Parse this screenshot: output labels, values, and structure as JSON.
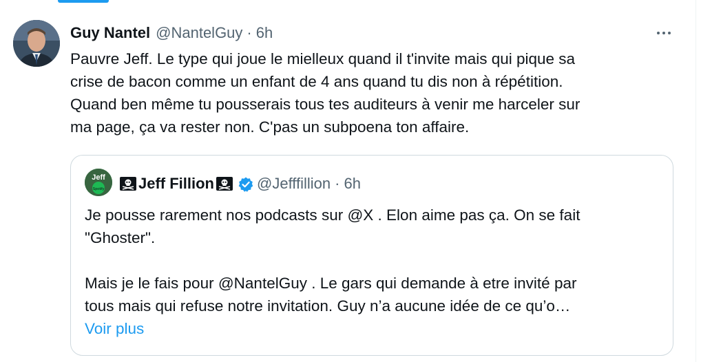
{
  "tweet": {
    "author_name": "Guy Nantel",
    "author_handle": "@NantelGuy",
    "separator": "·",
    "time": "6h",
    "text_lines": [
      "Pauvre Jeff. Le type qui joue le mielleux quand il t'invite mais qui pique sa",
      "crise de bacon comme un enfant de 4 ans quand tu dis non à répétition.",
      "Quand ben même tu pousserais tous tes auditeurs à venir me harceler sur",
      "ma page, ça va rester non. C'pas un subpoena ton affaire."
    ],
    "more_icon": "ellipsis-icon"
  },
  "quote": {
    "avatar_label_top": "Jeff",
    "avatar_label_bottom": "Spotify",
    "author_name": "Jeff Fillion",
    "author_handle": "@Jefffillion",
    "separator": "·",
    "time": "6h",
    "verified_icon": "verified-badge-icon",
    "skull_icon": "skull-crossbones-icon",
    "text_lines": [
      "Je pousse rarement nos podcasts sur @X . Elon aime pas ça. On se fait",
      "\"Ghoster\".",
      "",
      "Mais je le fais pour @NantelGuy . Le gars qui demande à etre invité par",
      "tous mais qui refuse notre invitation. Guy n’a aucune idée de ce qu’o…"
    ],
    "show_more": "Voir plus"
  },
  "colors": {
    "accent": "#1d9bf0",
    "text": "#0f1419",
    "secondary": "#536471",
    "border": "#cfd9de",
    "spotify": "#1db954"
  }
}
